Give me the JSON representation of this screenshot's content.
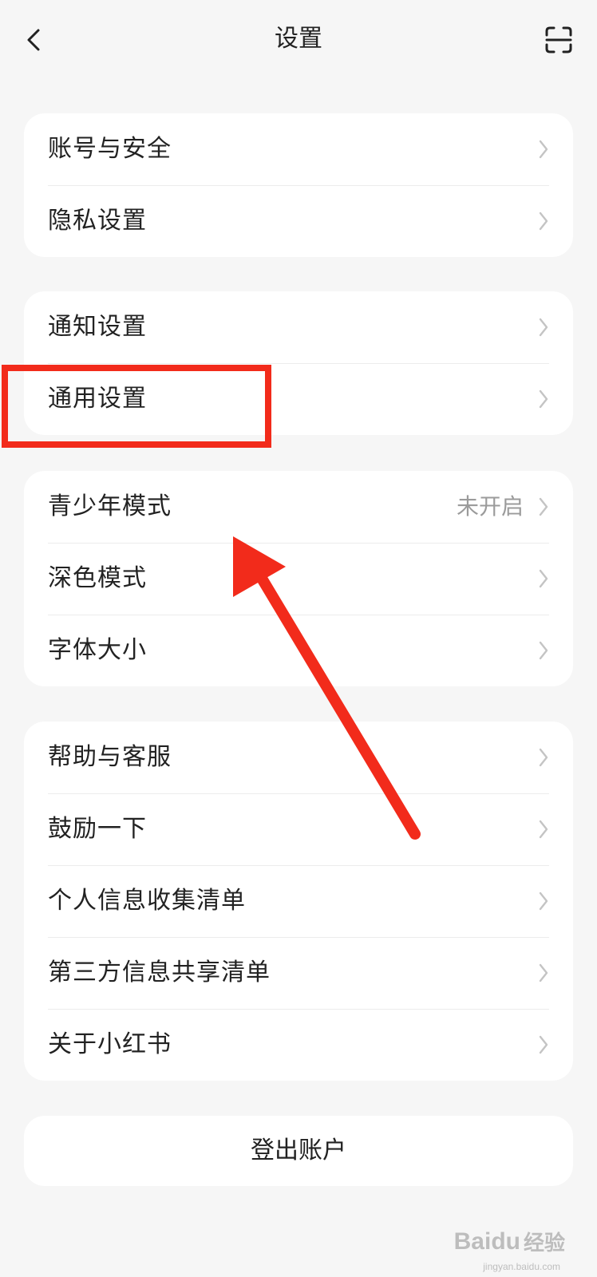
{
  "header": {
    "title": "设置",
    "back_icon": "chevron-left-icon",
    "scan_icon": "scan-icon"
  },
  "groups": [
    {
      "items": [
        {
          "label": "账号与安全"
        },
        {
          "label": "隐私设置"
        }
      ]
    },
    {
      "items": [
        {
          "label": "通知设置"
        },
        {
          "label": "通用设置"
        }
      ]
    },
    {
      "items": [
        {
          "label": "青少年模式",
          "value": "未开启"
        },
        {
          "label": "深色模式"
        },
        {
          "label": "字体大小"
        }
      ]
    },
    {
      "items": [
        {
          "label": "帮助与客服"
        },
        {
          "label": "鼓励一下"
        },
        {
          "label": "个人信息收集清单"
        },
        {
          "label": "第三方信息共享清单"
        },
        {
          "label": "关于小红书"
        }
      ]
    }
  ],
  "logout_label": "登出账户",
  "annotation_color": "#f22b1b",
  "watermark": {
    "brand": "Baidu",
    "suffix": "经验",
    "url": "jingyan.baidu.com"
  }
}
